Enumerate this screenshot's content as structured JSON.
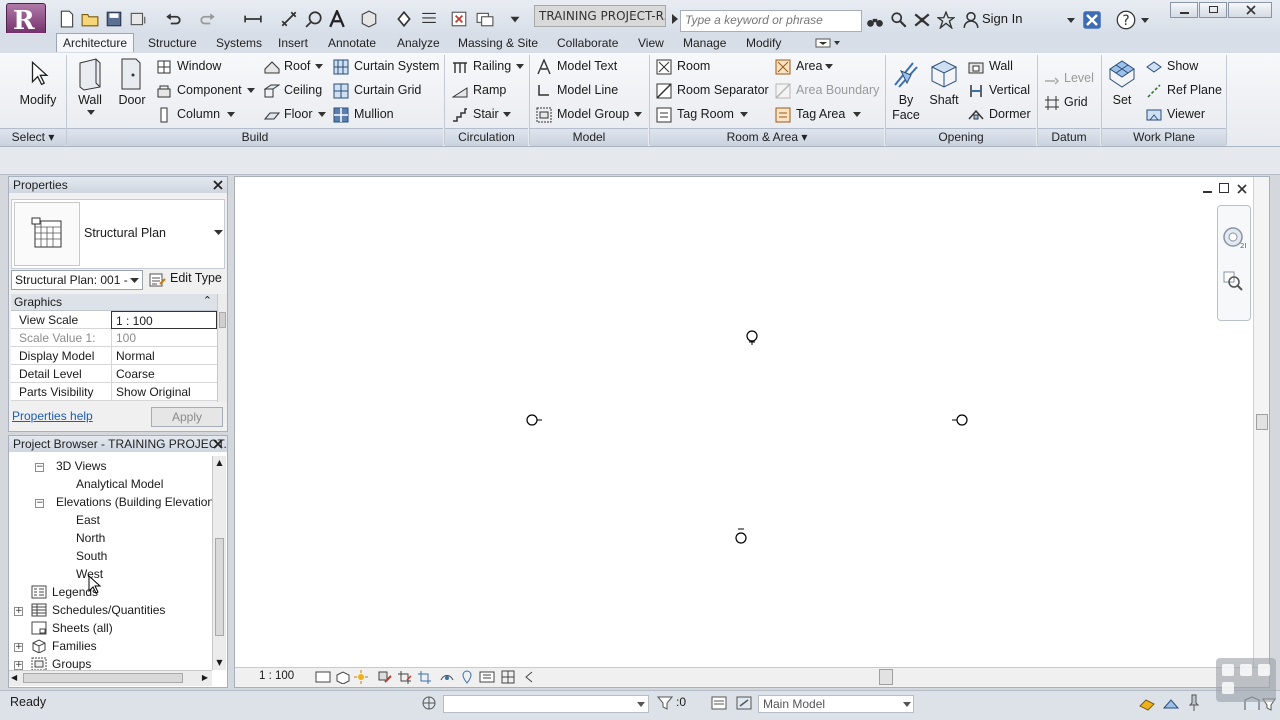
{
  "app": {
    "logo_letter": "R",
    "document_title": "TRAINING PROJECT-R...",
    "search_placeholder": "Type a keyword or phrase",
    "sign_in": "Sign In"
  },
  "tabs": [
    "Architecture",
    "Structure",
    "Systems",
    "Insert",
    "Annotate",
    "Analyze",
    "Massing & Site",
    "Collaborate",
    "View",
    "Manage",
    "Modify"
  ],
  "ribbon": {
    "select": {
      "modify": "Modify",
      "panel": "Select"
    },
    "build": {
      "wall": "Wall",
      "door": "Door",
      "window": "Window",
      "component": "Component",
      "column": "Column",
      "roof": "Roof",
      "ceiling": "Ceiling",
      "floor": "Floor",
      "curtain_system": "Curtain System",
      "curtain_grid": "Curtain Grid",
      "mullion": "Mullion",
      "panel": "Build"
    },
    "circulation": {
      "railing": "Railing",
      "ramp": "Ramp",
      "stair": "Stair",
      "panel": "Circulation"
    },
    "model": {
      "model_text": "Model Text",
      "model_line": "Model Line",
      "model_group": "Model Group",
      "panel": "Model"
    },
    "room_area": {
      "room": "Room",
      "room_separator": "Room Separator",
      "tag_room": "Tag Room",
      "area": "Area",
      "area_boundary": "Area Boundary",
      "tag_area": "Tag Area",
      "panel": "Room & Area"
    },
    "opening": {
      "by": "By",
      "face": "Face",
      "shaft": "Shaft",
      "wall": "Wall",
      "vertical": "Vertical",
      "dormer": "Dormer",
      "panel": "Opening"
    },
    "datum": {
      "level": "Level",
      "grid": "Grid",
      "panel": "Datum"
    },
    "work_plane": {
      "set": "Set",
      "show": "Show",
      "ref_plane": "Ref Plane",
      "viewer": "Viewer",
      "panel": "Work Plane"
    }
  },
  "properties": {
    "title": "Properties",
    "type_name": "Structural Plan",
    "instance": "Structural Plan: 001 -",
    "edit_type": "Edit Type",
    "group": "Graphics",
    "rows": [
      {
        "key": "View Scale",
        "value": "1 : 100",
        "disabled": false
      },
      {
        "key": "Scale Value    1:",
        "value": "100",
        "disabled": true
      },
      {
        "key": "Display Model",
        "value": "Normal",
        "disabled": false
      },
      {
        "key": "Detail Level",
        "value": "Coarse",
        "disabled": false
      },
      {
        "key": "Parts Visibility",
        "value": "Show Original",
        "disabled": false
      }
    ],
    "help": "Properties help",
    "apply": "Apply"
  },
  "browser": {
    "title": "Project Browser - TRAINING PROJECT...",
    "items": {
      "views_3d": "3D Views",
      "analytical_model": "Analytical Model",
      "elevations": "Elevations (Building Elevation",
      "east": "East",
      "north": "North",
      "south": "South",
      "west": "West",
      "legends": "Legends",
      "schedules": "Schedules/Quantities",
      "sheets": "Sheets (all)",
      "families": "Families",
      "groups": "Groups"
    }
  },
  "view": {
    "scale": "1 : 100"
  },
  "status": {
    "text": "Ready",
    "count": ":0",
    "model": "Main Model"
  }
}
